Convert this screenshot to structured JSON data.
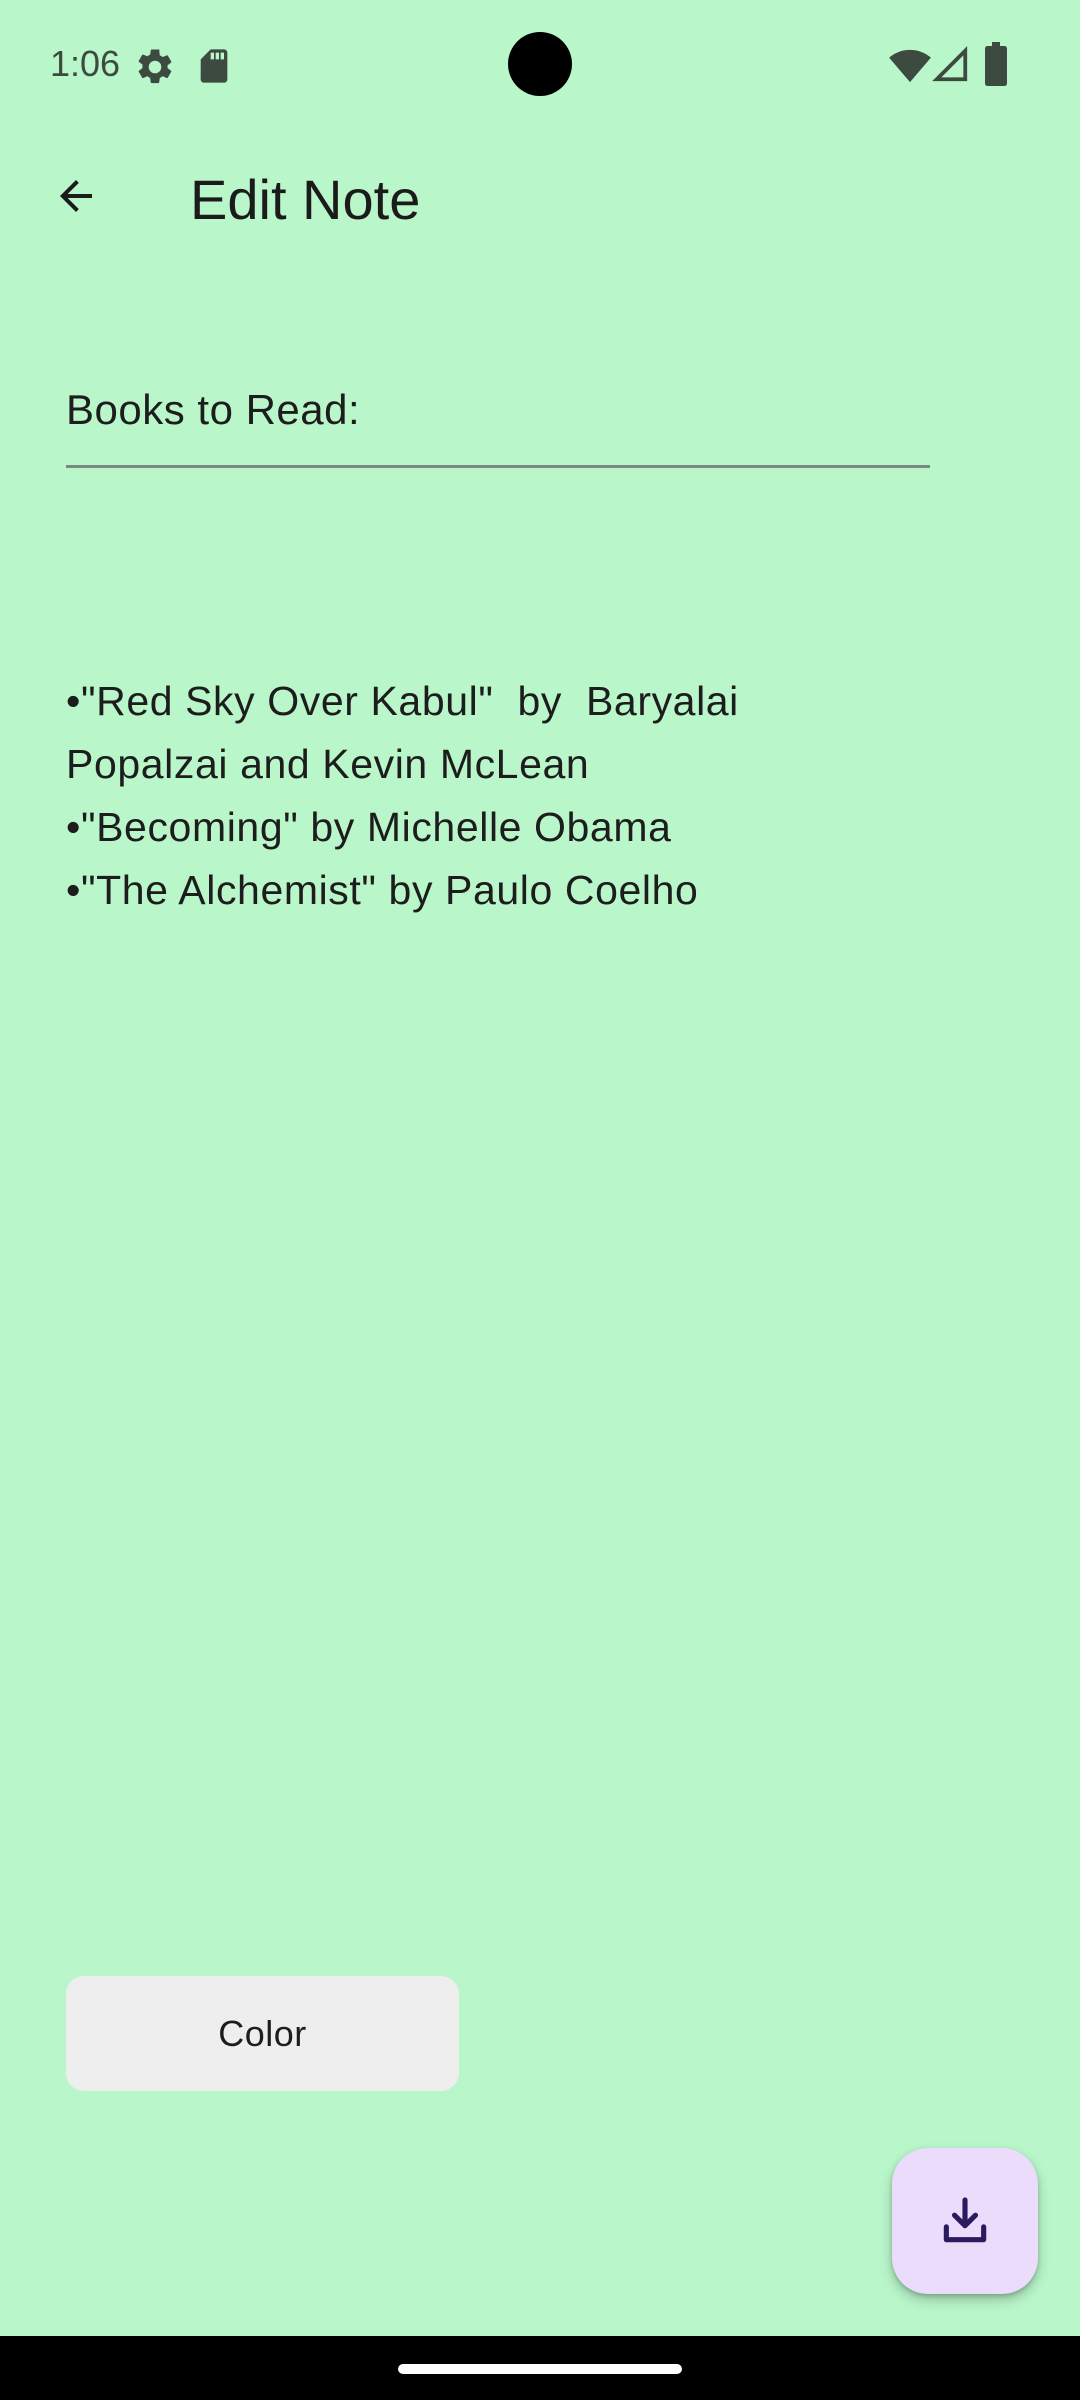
{
  "status_bar": {
    "time": "1:06",
    "left_icons": [
      "settings-icon",
      "sd-card-icon"
    ],
    "right_icons": [
      "wifi-icon",
      "cellular-signal-icon",
      "battery-icon"
    ]
  },
  "app_bar": {
    "back_icon": "arrow-back-icon",
    "title": "Edit Note"
  },
  "note": {
    "title_value": "Books to Read:",
    "body_lines": [
      "•\"Red Sky Over Kabul\"  by  Baryalai",
      "Popalzai and Kevin McLean",
      "•\"Becoming\" by Michelle Obama",
      "•\"The Alchemist\" by Paulo Coelho"
    ]
  },
  "actions": {
    "color_button_label": "Color",
    "save_fab_icon": "download-icon"
  },
  "colors": {
    "background": "#b9f6ca",
    "color_button_bg": "#eeeeee",
    "fab_bg": "#ecdcfb",
    "fab_icon": "#2a1a5e"
  }
}
